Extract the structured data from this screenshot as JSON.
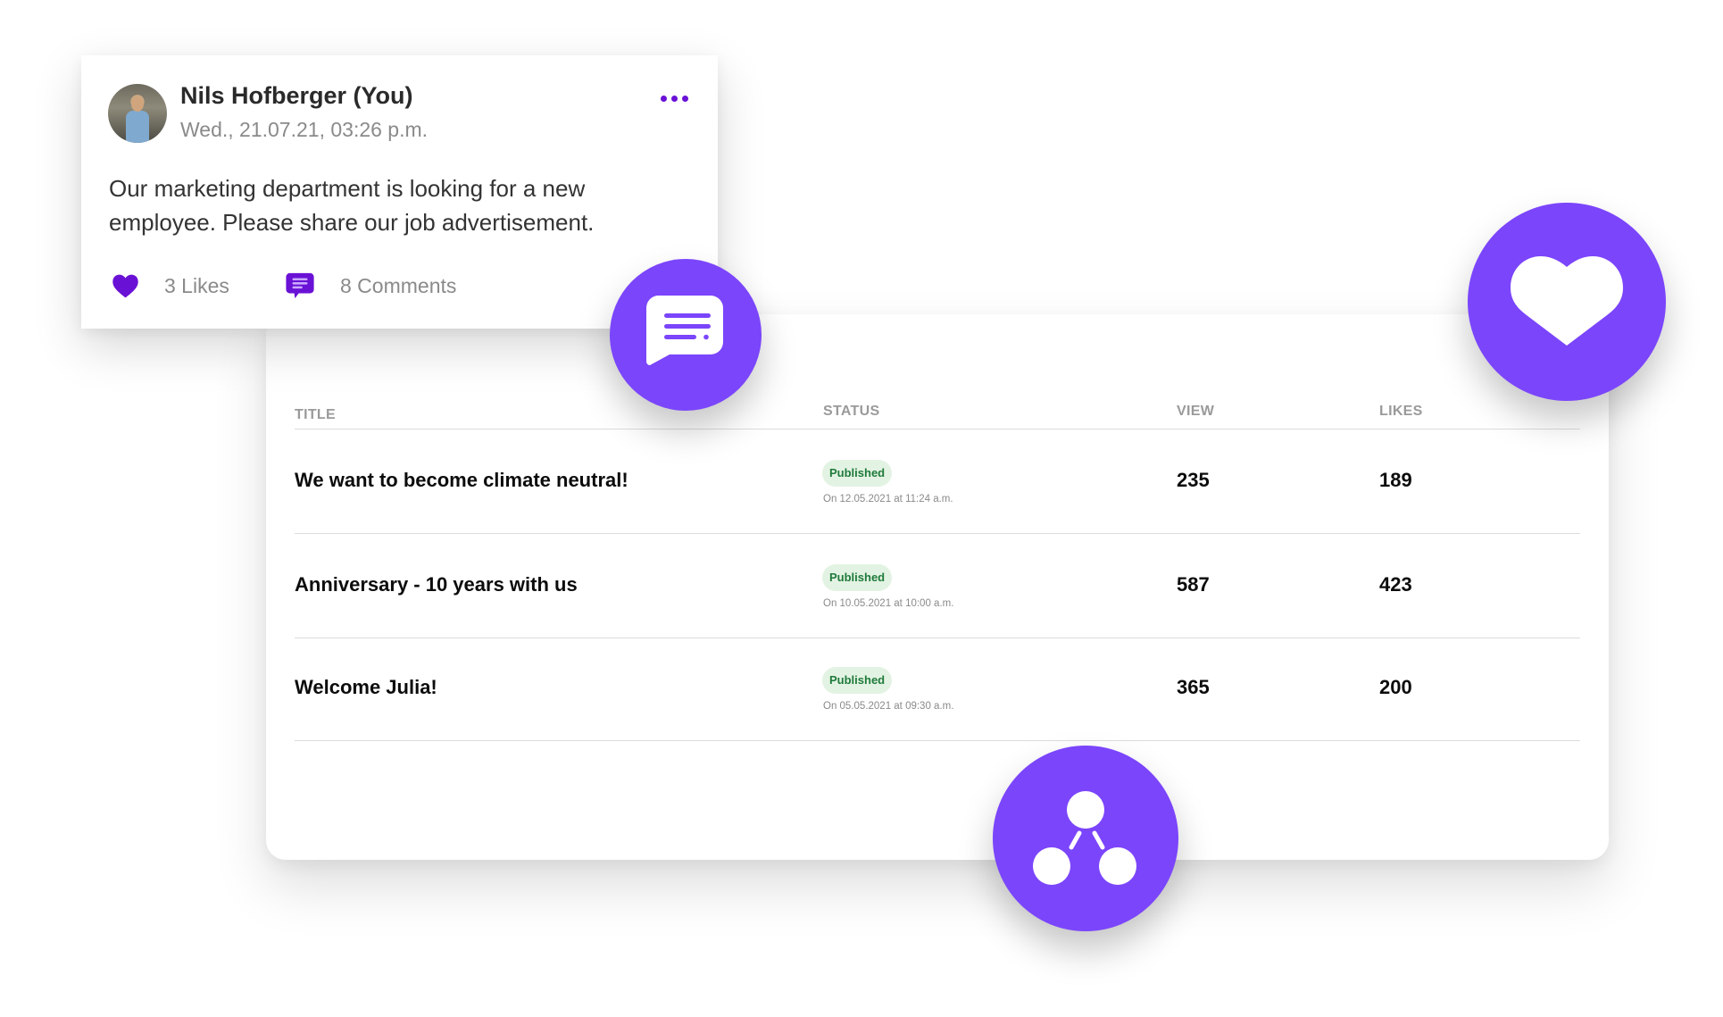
{
  "post": {
    "author": "Nils Hofberger (You)",
    "timestamp": "Wed., 21.07.21, 03:26 p.m.",
    "body": "Our marketing department is looking for a new employee. Please share our job advertisement.",
    "likes_label": "3 Likes",
    "comments_label": "8 Comments",
    "more_icon": "more-horizontal-icon",
    "like_icon": "heart-icon",
    "comment_icon": "comment-icon"
  },
  "table": {
    "headers": {
      "title": "TITLE",
      "status": "STATUS",
      "view": "VIEW",
      "likes": "LIKES"
    },
    "rows": [
      {
        "title": "We want to become climate neutral!",
        "status": "Published",
        "date": "On 12.05.2021 at 11:24 a.m.",
        "views": "235",
        "likes": "189"
      },
      {
        "title": "Anniversary - 10 years with us",
        "status": "Published",
        "date": "On 10.05.2021 at 10:00 a.m.",
        "views": "587",
        "likes": "423"
      },
      {
        "title": "Welcome Julia!",
        "status": "Published",
        "date": "On 05.05.2021 at 09:30 a.m.",
        "views": "365",
        "likes": "200"
      }
    ]
  },
  "floating_buttons": [
    {
      "icon": "chat-bubble-icon"
    },
    {
      "icon": "heart-icon"
    },
    {
      "icon": "share-icon"
    }
  ],
  "colors": {
    "accent": "#7b45fb",
    "icon_purple": "#6a11d6",
    "badge_bg": "#e3f3e3",
    "badge_text": "#1f7a3b"
  }
}
